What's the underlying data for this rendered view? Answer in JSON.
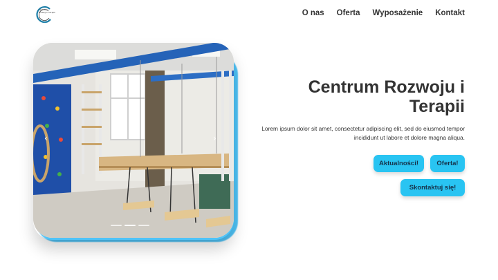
{
  "header": {
    "logo_text": "centrum rozwoju i terapii",
    "nav": [
      {
        "label": "O nas"
      },
      {
        "label": "Oferta"
      },
      {
        "label": "Wyposażenie"
      },
      {
        "label": "Kontakt"
      }
    ]
  },
  "hero": {
    "title": "Centrum Rozwoju i Terapii",
    "subtitle": "Lorem ipsum dolor sit amet, consectetur adipiscing elit, sed do eiusmod tempor incididunt ut labore et dolore magna aliqua.",
    "buttons": {
      "news": "Aktualności!",
      "offer": "Oferta!",
      "contact": "Skontaktuj się!"
    }
  },
  "slider": {
    "prev_icon": "chevron-left-icon",
    "next_icon": "chevron-right-icon",
    "slide_count": 3,
    "active_slide": 2
  },
  "colors": {
    "accent": "#29c4f2",
    "glow": "#4fc3f7",
    "text": "#333333"
  }
}
